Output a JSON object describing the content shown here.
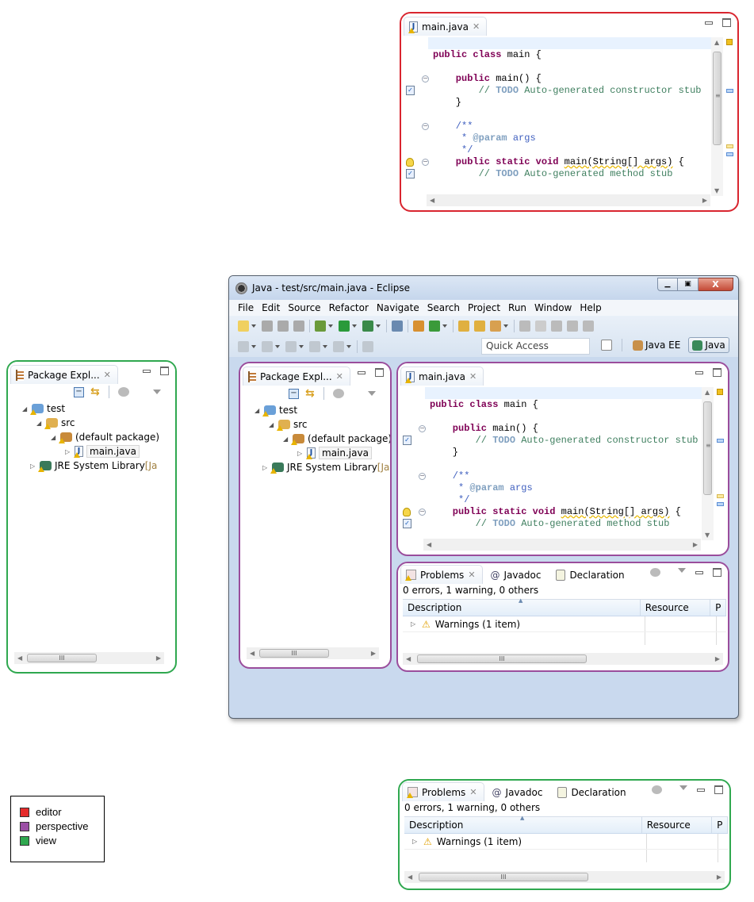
{
  "legend": {
    "items": [
      {
        "label": "editor",
        "color": "#e52b2b"
      },
      {
        "label": "perspective",
        "color": "#9b4fa5"
      },
      {
        "label": "view",
        "color": "#2fa84f"
      }
    ]
  },
  "editor": {
    "tab_label": "main.java",
    "lines": [
      [],
      [
        {
          "t": "public class ",
          "c": "kw"
        },
        {
          "t": "main {",
          "c": "pl"
        }
      ],
      [],
      [
        {
          "t": "    public ",
          "c": "kw"
        },
        {
          "t": "main() {",
          "c": "pl"
        }
      ],
      [
        {
          "t": "        // ",
          "c": "cm"
        },
        {
          "t": "TODO",
          "c": "todo"
        },
        {
          "t": " Auto-generated constructor stub",
          "c": "cm"
        }
      ],
      [
        {
          "t": "    }",
          "c": "pl"
        }
      ],
      [],
      [
        {
          "t": "    /**",
          "c": "jd"
        }
      ],
      [
        {
          "t": "     * ",
          "c": "jd"
        },
        {
          "t": "@param",
          "c": "tag"
        },
        {
          "t": " args",
          "c": "jd"
        }
      ],
      [
        {
          "t": "     */",
          "c": "jd"
        }
      ],
      [
        {
          "t": "    public static void ",
          "c": "kw"
        },
        {
          "t": "main(String[] args)",
          "c": "pl warnline"
        },
        {
          "t": " {",
          "c": "pl"
        }
      ],
      [
        {
          "t": "        // ",
          "c": "cm"
        },
        {
          "t": "TODO",
          "c": "todo"
        },
        {
          "t": " Auto-generated method stub",
          "c": "cm"
        }
      ]
    ]
  },
  "package_explorer": {
    "tab_label": "Package Expl...",
    "tree": [
      {
        "label": "test",
        "depth": 0,
        "expander": "open",
        "icon": "project-icon"
      },
      {
        "label": "src",
        "depth": 1,
        "expander": "open",
        "icon": "source-folder-icon"
      },
      {
        "label": "(default package)",
        "depth": 2,
        "expander": "open",
        "icon": "package-icon"
      },
      {
        "label": "main.java",
        "depth": 3,
        "expander": "closed",
        "icon": "java-file-icon",
        "selected": true
      },
      {
        "label": "JRE System Library",
        "suffix": " [Ja",
        "depth": 1,
        "expander": "closed",
        "icon": "library-icon",
        "outdent": true
      }
    ]
  },
  "problems": {
    "tabs": [
      {
        "label": "Problems",
        "icon": "problems-icon",
        "closable": true
      },
      {
        "label": "Javadoc",
        "icon": "at-icon"
      },
      {
        "label": "Declaration",
        "icon": "declaration-icon"
      }
    ],
    "summary": "0 errors, 1 warning, 0 others",
    "columns": [
      "Description",
      "Resource",
      "P"
    ],
    "rows": [
      {
        "label": "Warnings (1 item)",
        "icon": "warning-icon"
      }
    ]
  },
  "window": {
    "title": "Java - test/src/main.java - Eclipse",
    "menu": [
      "File",
      "Edit",
      "Source",
      "Refactor",
      "Navigate",
      "Search",
      "Project",
      "Run",
      "Window",
      "Help"
    ],
    "quick_access": "Quick Access",
    "perspectives": [
      {
        "label": "Java EE",
        "active": false
      },
      {
        "label": "Java",
        "active": true
      }
    ]
  }
}
